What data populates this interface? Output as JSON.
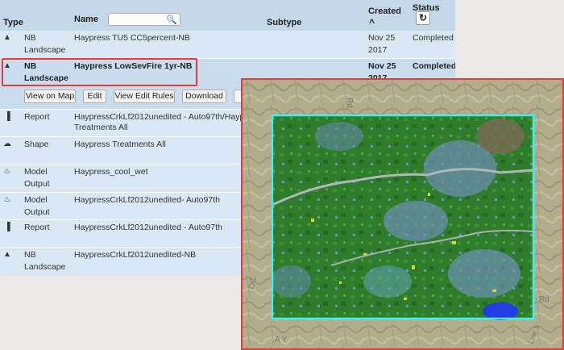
{
  "columns": {
    "type": "Type",
    "name": "Name",
    "subtype": "Subtype",
    "created": "Created",
    "created_sort": "^",
    "status": "Status"
  },
  "search": {
    "placeholder": ""
  },
  "rows": [
    {
      "type1": "NB",
      "type2": "Landscape",
      "name1": "Haypress TU5 CC5percent-NB",
      "name2": "",
      "created1": "Nov 25",
      "created2": "2017",
      "status": "Completed",
      "icon": "tree-icon"
    },
    {
      "type1": "NB",
      "type2": "Landscape",
      "name1": "Haypress LowSevFire 1yr-NB",
      "name2": "",
      "created1": "Nov 25",
      "created2": "2017",
      "status": "Completed",
      "icon": "tree-icon"
    },
    {
      "type1": "Report",
      "type2": "",
      "name1": "HaypressCrkLf2012unedited - Auto97th/Haypres",
      "name2": "Treatments All",
      "icon": "bar-chart-icon"
    },
    {
      "type1": "Shape",
      "type2": "",
      "name1": "Haypress Treatments All",
      "name2": "",
      "icon": "cloud-icon"
    },
    {
      "type1": "Model",
      "type2": "Output",
      "name1": "Haypress_cool_wet",
      "name2": "",
      "icon": "fire-icon"
    },
    {
      "type1": "Model",
      "type2": "Output",
      "name1": "HaypressCrkLf2012unedited- Auto97th",
      "name2": "",
      "icon": "fire-icon"
    },
    {
      "type1": "Report",
      "type2": "",
      "name1": "HaypressCrkLf2012unedited - Auto97th",
      "name2": "",
      "icon": "bar-chart-icon"
    },
    {
      "type1": "NB",
      "type2": "Landscape",
      "name1": "HaypressCrkLf2012unedited-NB",
      "name2": "",
      "icon": "tree-icon"
    }
  ],
  "actions": {
    "view_on_map": "View on Map",
    "edit": "Edit",
    "view_edit_rules": "View Edit Rules",
    "download": "Download"
  },
  "map": {
    "road_label_top": "Rd",
    "road_label_right": "Rd",
    "label_left": "OC",
    "label_bottom": "A Y",
    "label_br": "Line 1"
  }
}
